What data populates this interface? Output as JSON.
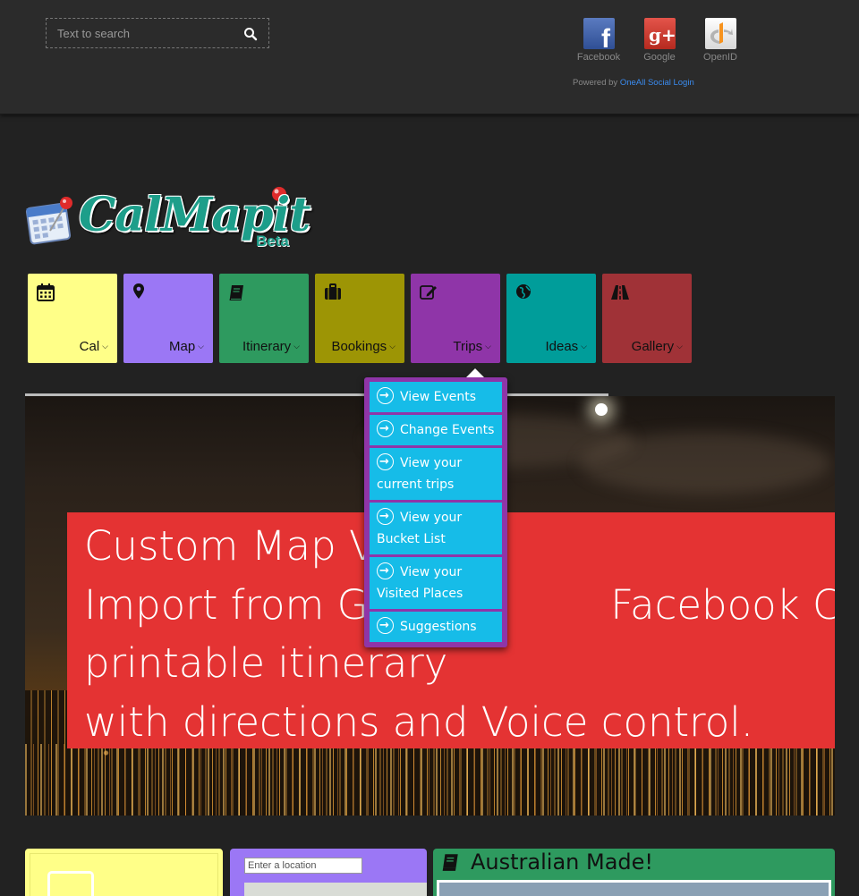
{
  "header": {
    "search_placeholder": "Text to search",
    "social": [
      {
        "label": "Facebook",
        "icon": "facebook-icon"
      },
      {
        "label": "Google",
        "icon": "google-plus-icon"
      },
      {
        "label": "OpenID",
        "icon": "openid-icon"
      }
    ],
    "powered_prefix": "Powered by",
    "powered_link": "OneAll Social Login"
  },
  "brand": {
    "name": "CalMapit",
    "beta": "Beta"
  },
  "nav": [
    {
      "label": "Cal",
      "icon": "calendar-icon",
      "color": "#ffff88"
    },
    {
      "label": "Map",
      "icon": "map-marker-icon",
      "color": "#9b77f5"
    },
    {
      "label": "Itinerary",
      "icon": "book-icon",
      "color": "#2e9a5f"
    },
    {
      "label": "Bookings",
      "icon": "suitcase-icon",
      "color": "#9d9505"
    },
    {
      "label": "Trips",
      "icon": "edit-icon",
      "color": "#8f35a8"
    },
    {
      "label": "Ideas",
      "icon": "globe-icon",
      "color": "#009d9a"
    },
    {
      "label": "Gallery",
      "icon": "road-icon",
      "color": "#a03237"
    }
  ],
  "dropdown": {
    "items": [
      {
        "l1": "View Events",
        "l2": ""
      },
      {
        "l1": "Change Events",
        "l2": ""
      },
      {
        "l1": "View your",
        "l2": "current trips"
      },
      {
        "l1": "View your",
        "l2": "Bucket List"
      },
      {
        "l1": "View your",
        "l2": "Visited Places"
      },
      {
        "l1": "Suggestions",
        "l2": ""
      }
    ]
  },
  "hero": {
    "lines": [
      "Custom Map Vi",
      "Import from Go                 Facebook Calend",
      "printable itinerary",
      "with directions and Voice control."
    ]
  },
  "cards": {
    "location_placeholder": "Enter a location",
    "made_title": "Australian Made!"
  },
  "colors": {
    "accent_red": "#e43333",
    "dropdown_bg": "#8f35a8",
    "dropdown_item": "#16bce8"
  }
}
